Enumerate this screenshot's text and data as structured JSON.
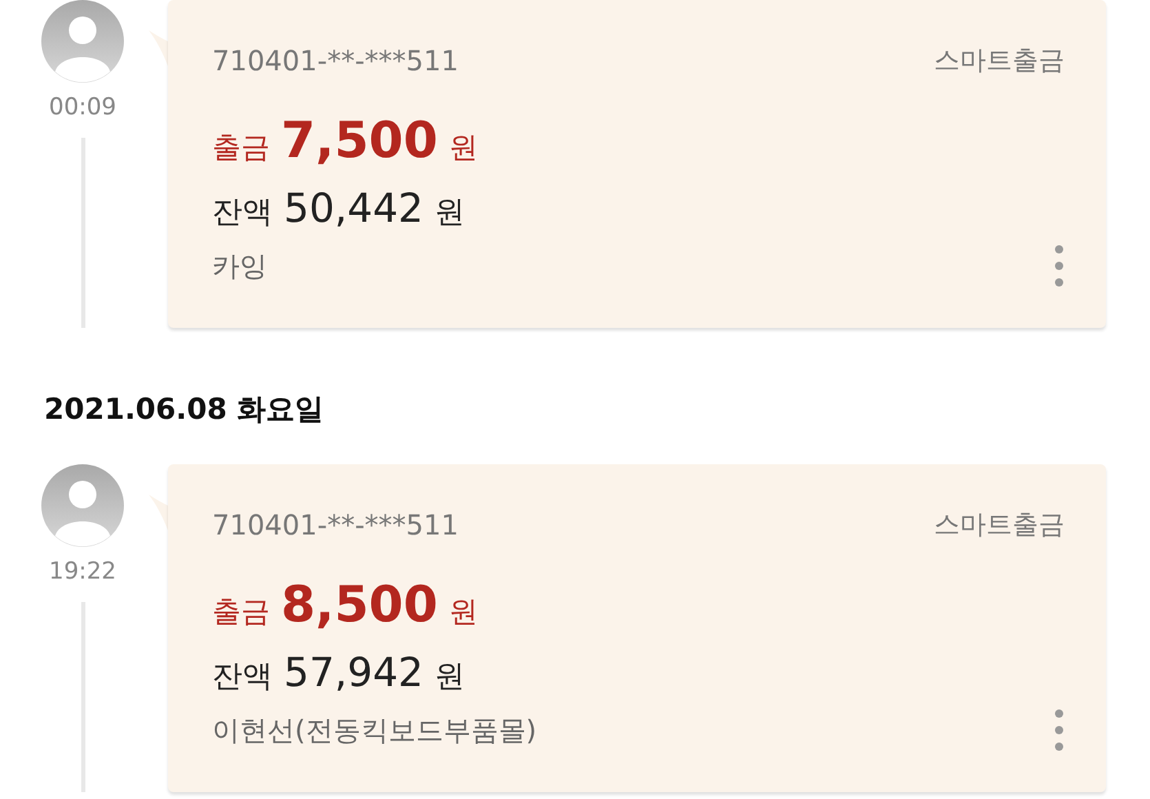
{
  "timeline": [
    {
      "kind": "transaction",
      "time": "00:09",
      "account": "710401-**-***511",
      "method": "스마트출금",
      "type_label": "출금",
      "amount": "7,500",
      "amount_unit": "원",
      "balance_label": "잔액",
      "balance": "50,442",
      "balance_unit": "원",
      "memo": "카잉"
    },
    {
      "kind": "date",
      "text": "2021.06.08 화요일"
    },
    {
      "kind": "transaction",
      "time": "19:22",
      "account": "710401-**-***511",
      "method": "스마트출금",
      "type_label": "출금",
      "amount": "8,500",
      "amount_unit": "원",
      "balance_label": "잔액",
      "balance": "57,942",
      "balance_unit": "원",
      "memo": "이현선(전동킥보드부품몰)"
    }
  ]
}
